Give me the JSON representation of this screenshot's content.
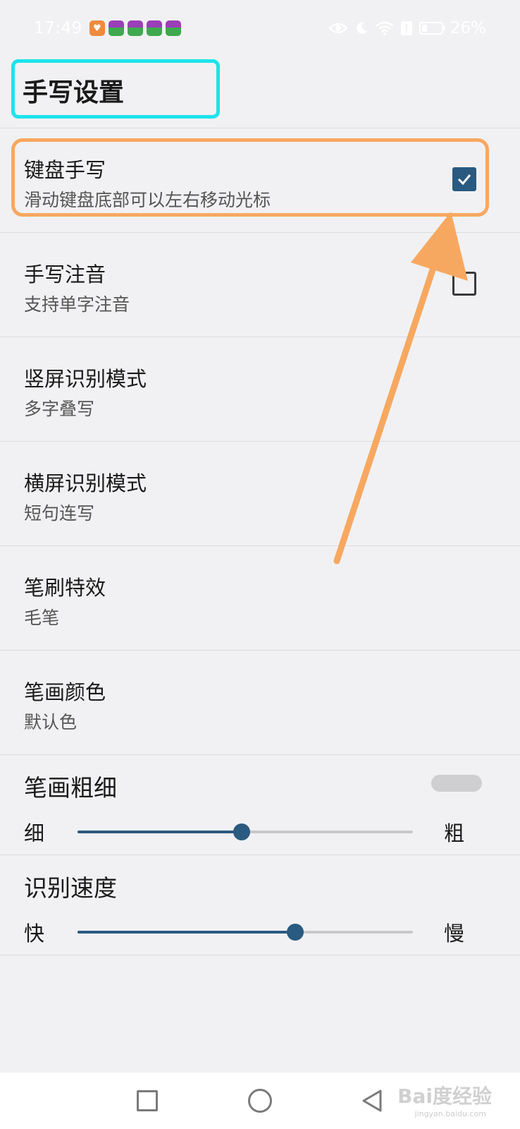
{
  "status_bar": {
    "time": "17:49",
    "battery_text": "26%",
    "battery_level": 0.26,
    "icons": [
      "eye-icon",
      "moon-icon",
      "wifi-icon",
      "alert-icon",
      "battery-saver-icon"
    ]
  },
  "page": {
    "title": "手写设置"
  },
  "settings": [
    {
      "title": "键盘手写",
      "subtitle": "滑动键盘底部可以左右移动光标",
      "checkbox": true
    },
    {
      "title": "手写注音",
      "subtitle": "支持单字注音",
      "checkbox": false
    },
    {
      "title": "竖屏识别模式",
      "subtitle": "多字叠写"
    },
    {
      "title": "横屏识别模式",
      "subtitle": "短句连写"
    },
    {
      "title": "笔刷特效",
      "subtitle": "毛笔"
    },
    {
      "title": "笔画颜色",
      "subtitle": "默认色"
    }
  ],
  "sliders": [
    {
      "title": "笔画粗细",
      "min_label": "细",
      "max_label": "粗",
      "value": 0.49
    },
    {
      "title": "识别速度",
      "min_label": "快",
      "max_label": "慢",
      "value": 0.65
    }
  ],
  "watermark": {
    "brand": "Bai度经验",
    "domain": "jingyan.baidu.com"
  },
  "colors": {
    "accent": "#2a5a80",
    "title_highlight": "#1de3ec",
    "annotation": "#f7a860",
    "background": "#f1f1f3"
  }
}
